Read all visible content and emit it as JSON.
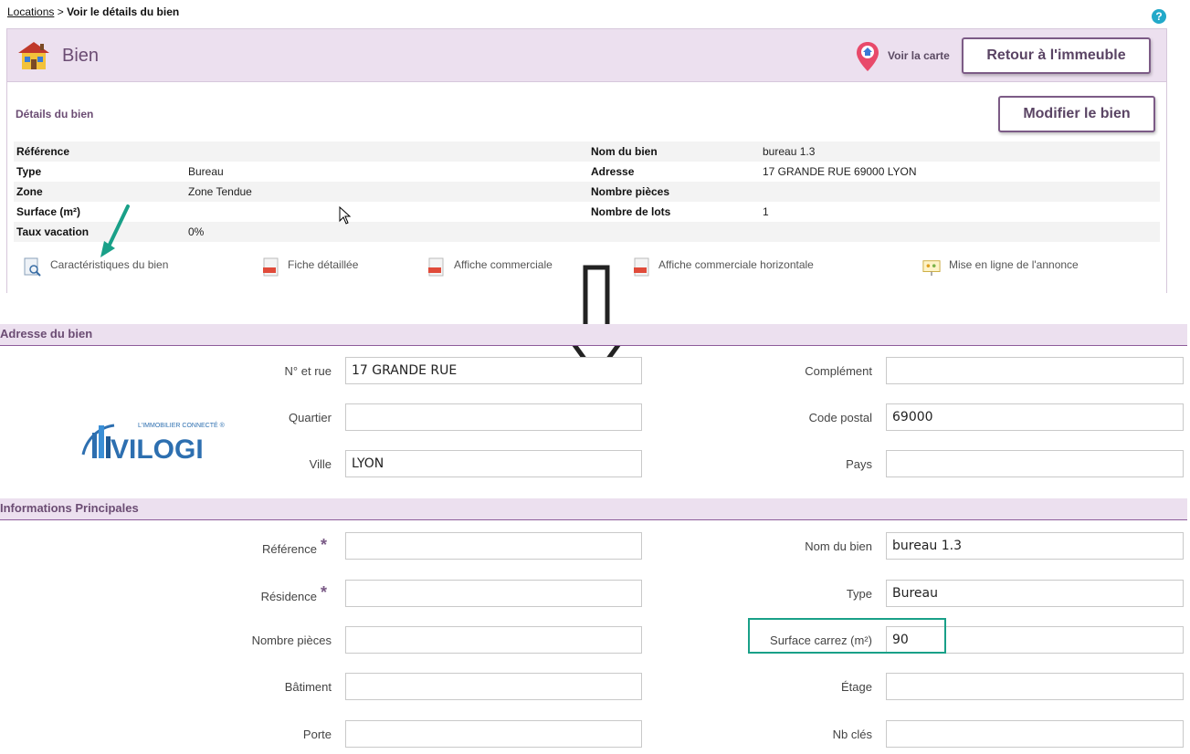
{
  "breadcrumb": {
    "link": "Locations",
    "separator": " > ",
    "current": "Voir le détails du bien"
  },
  "help": {
    "label": "?"
  },
  "header": {
    "title": "Bien",
    "map_link": "Voir la carte",
    "back_button": "Retour à l'immeuble"
  },
  "details": {
    "title": "Détails du bien",
    "edit_button": "Modifier le bien",
    "rows": [
      {
        "l1": "Référence",
        "v1": "",
        "l2": "Nom du bien",
        "v2": "bureau 1.3"
      },
      {
        "l1": "Type",
        "v1": "Bureau",
        "l2": "Adresse",
        "v2": "17 GRANDE RUE 69000 LYON"
      },
      {
        "l1": "Zone",
        "v1": "Zone Tendue",
        "l2": "Nombre pièces",
        "v2": ""
      },
      {
        "l1": "Surface (m²)",
        "v1": "",
        "l2": "Nombre de lots",
        "v2": "1"
      },
      {
        "l1": "Taux vacation",
        "v1": "0%",
        "l2": "",
        "v2": ""
      }
    ],
    "links": [
      "Caractéristiques du bien",
      "Fiche détaillée",
      "Affiche commerciale",
      "Affiche commerciale horizontale",
      "Mise en ligne de l'annonce"
    ]
  },
  "address_section": {
    "title": "Adresse du bien",
    "fields": {
      "street": {
        "label": "N° et rue",
        "value": "17 GRANDE RUE"
      },
      "district": {
        "label": "Quartier",
        "value": ""
      },
      "city": {
        "label": "Ville",
        "value": "LYON"
      },
      "complement": {
        "label": "Complément",
        "value": ""
      },
      "postal": {
        "label": "Code postal",
        "value": "69000"
      },
      "country": {
        "label": "Pays",
        "value": ""
      }
    }
  },
  "logo": {
    "tagline": "L'IMMOBILIER CONNECTÉ ®",
    "name": "VILOGI"
  },
  "main_section": {
    "title": "Informations Principales",
    "fields": {
      "reference": {
        "label": "Référence",
        "value": ""
      },
      "residence": {
        "label": "Résidence",
        "value": ""
      },
      "rooms": {
        "label": "Nombre pièces",
        "value": ""
      },
      "building": {
        "label": "Bâtiment",
        "value": ""
      },
      "door": {
        "label": "Porte",
        "value": ""
      },
      "name": {
        "label": "Nom du bien",
        "value": "bureau 1.3"
      },
      "type": {
        "label": "Type",
        "value": "Bureau"
      },
      "surface": {
        "label": "Surface carrez (m²)",
        "value": "90"
      },
      "floor": {
        "label": "Étage",
        "value": ""
      },
      "keys": {
        "label": "Nb clés",
        "value": ""
      }
    },
    "required_mark": "*"
  },
  "colors": {
    "accent": "#6b4c73",
    "header_bg": "#ece0ef",
    "highlight": "#19a088",
    "help": "#22a9c9"
  }
}
